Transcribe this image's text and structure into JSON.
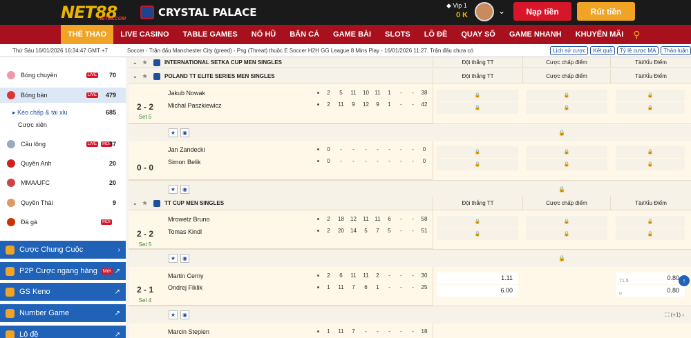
{
  "header": {
    "logo": "NET88",
    "logo_sub": "NET88.COM",
    "club": "CRYSTAL PALACE",
    "vip": "Vip 1",
    "balance": "0 K",
    "deposit": "Nạp tiền",
    "withdraw": "Rút tiền"
  },
  "nav": [
    "THỂ THAO",
    "LIVE CASINO",
    "TABLE GAMES",
    "NỔ HŨ",
    "BẮN CÁ",
    "GAME BÀI",
    "SLOTS",
    "LÔ ĐỀ",
    "QUAY SỐ",
    "GAME NHANH",
    "KHUYẾN MÃI"
  ],
  "ticker": {
    "clock": "Thứ Sáu 16/01/2026 16:34:47 GMT +7",
    "news": "Soccer - Trận đấu Manchester City (greed) - Psg (Threat) thuộc E Soccer H2H GG League 8 Mins Play - 16/01/2026 11:27. Trận đấu chưa có",
    "history": "Lịch sử cược",
    "results": "Kết quả",
    "odds_type": "Tỷ lệ cược MA",
    "discuss": "Thảo luận"
  },
  "sidebar": {
    "sports": [
      {
        "label": "Bóng chuyền",
        "live": "LIVE",
        "count": "70",
        "color": "#e9a"
      },
      {
        "label": "Bóng bàn",
        "live": "LIVE",
        "count": "479",
        "color": "#d33"
      },
      {
        "label": "Kèo chấp & tài xỉu",
        "count": "685",
        "color": ""
      },
      {
        "label": "Cược xiên",
        "count": "",
        "color": ""
      },
      {
        "label": "Cầu lông",
        "live": "LIVE",
        "new": "MỚI",
        "count": "37",
        "color": "#9ab"
      },
      {
        "label": "Quyền Anh",
        "count": "20",
        "color": "#c22"
      },
      {
        "label": "MMA/UFC",
        "count": "20",
        "color": "#c44"
      },
      {
        "label": "Quyền Thái",
        "count": "9",
        "color": "#d96"
      },
      {
        "label": "Đá gà",
        "new": "MỚI",
        "count": "",
        "color": "#c30"
      }
    ],
    "blue": [
      "Cược Chung Cuộc",
      "P2P Cược ngang hàng",
      "GS Keno",
      "Number Game",
      "Lô đề"
    ],
    "p2p_badge": "Mới"
  },
  "leagues": {
    "l1": "INTERNATIONAL SETKA CUP MEN SINGLES",
    "l2": "POLAND TT ELITE SERIES MEN SINGLES",
    "l3": "TT CUP MEN SINGLES"
  },
  "columns": {
    "win": "Đội thắng TT",
    "handicap": "Cược chấp điểm",
    "ou": "Tài/Xỉu Điểm"
  },
  "matches": [
    {
      "score": "2 - 2",
      "set": "Set 5",
      "home": "Jakub Nowak",
      "away": "Michal Paszkiewicz",
      "home_scores": [
        "2",
        "5",
        "11",
        "10",
        "11",
        "1",
        "-",
        "-",
        "38"
      ],
      "away_scores": [
        "2",
        "11",
        "9",
        "12",
        "9",
        "1",
        "-",
        "-",
        "42"
      ]
    },
    {
      "score": "0 - 0",
      "set": "",
      "home": "Jan Zandecki",
      "away": "Simon Belik",
      "home_scores": [
        "0",
        "-",
        "-",
        "-",
        "-",
        "-",
        "-",
        "-",
        "0"
      ],
      "away_scores": [
        "0",
        "-",
        "-",
        "-",
        "-",
        "-",
        "-",
        "-",
        "0"
      ]
    },
    {
      "score": "2 - 2",
      "set": "Set 5",
      "home": "Mrowetz Bruno",
      "away": "Tomas Kindl",
      "home_scores": [
        "2",
        "18",
        "12",
        "11",
        "11",
        "6",
        "-",
        "-",
        "58"
      ],
      "away_scores": [
        "2",
        "20",
        "14",
        "5",
        "7",
        "5",
        "-",
        "-",
        "51"
      ]
    },
    {
      "score": "2 - 1",
      "set": "Set 4",
      "home": "Martin Cerny",
      "away": "Ondrej Fiklik",
      "home_scores": [
        "2",
        "6",
        "11",
        "11",
        "2",
        "-",
        "-",
        "-",
        "30"
      ],
      "away_scores": [
        "1",
        "11",
        "7",
        "6",
        "1",
        "-",
        "-",
        "-",
        "25"
      ],
      "odds": {
        "home": "1.11",
        "away": "6.00",
        "ou_line": "71.5",
        "ou_under": "u",
        "ou_over_odds": "0.80",
        "ou_under_odds": "0.80"
      }
    },
    {
      "home": "Marcin Stepien",
      "home_scores": [
        "1",
        "11",
        "7",
        "-",
        "-",
        "-",
        "-",
        "-",
        "18"
      ]
    }
  ],
  "more": "(+1)"
}
